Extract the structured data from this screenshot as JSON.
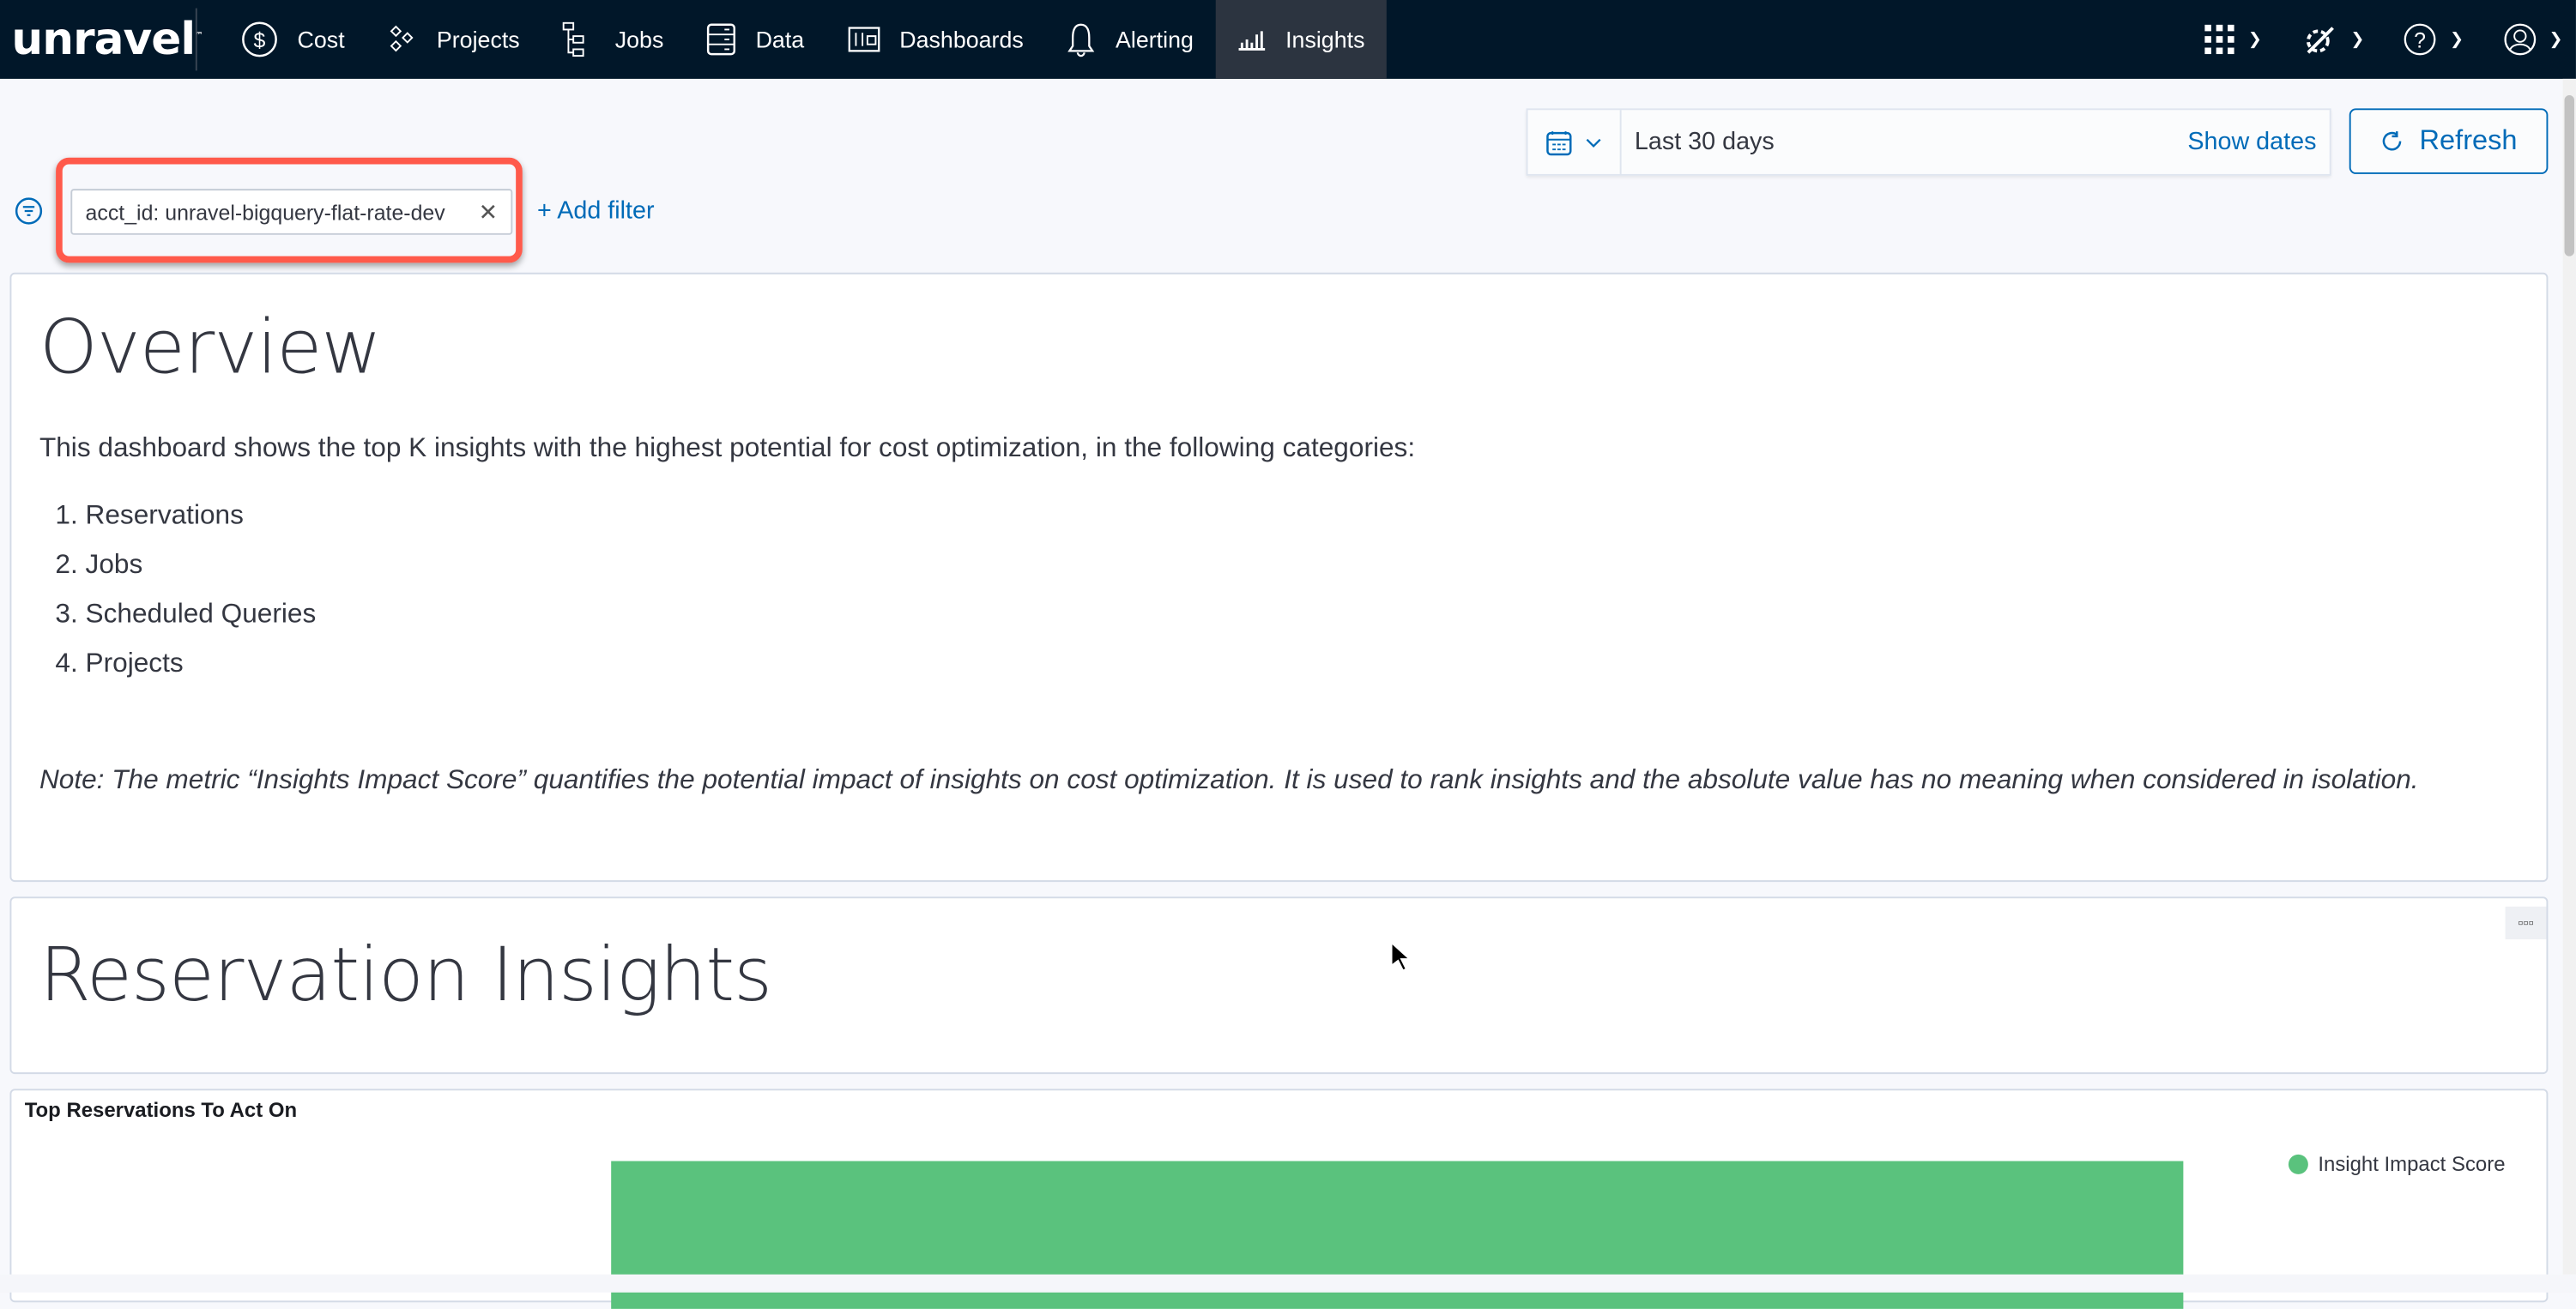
{
  "nav": {
    "logo": "unravel",
    "items": [
      {
        "label": "Cost",
        "icon": "dollar-circle-icon"
      },
      {
        "label": "Projects",
        "icon": "projects-icon"
      },
      {
        "label": "Jobs",
        "icon": "jobs-icon"
      },
      {
        "label": "Data",
        "icon": "database-icon"
      },
      {
        "label": "Dashboards",
        "icon": "dashboard-icon"
      },
      {
        "label": "Alerting",
        "icon": "bell-icon"
      },
      {
        "label": "Insights",
        "icon": "bar-chart-icon",
        "active": true
      }
    ],
    "right_icons": [
      "apps-grid-icon",
      "settings-wrench-icon",
      "help-icon",
      "user-icon"
    ]
  },
  "toolbar": {
    "date_range": "Last 30 days",
    "show_dates": "Show dates",
    "refresh": "Refresh"
  },
  "filters": {
    "active": [
      {
        "label": "acct_id: unravel-bigquery-flat-rate-dev"
      }
    ],
    "add_filter": "+ Add filter",
    "highlight_color": "#ff5a4b"
  },
  "overview": {
    "title": "Overview",
    "intro": "This dashboard shows the top K insights with the highest potential for cost optimization, in the following categories:",
    "categories": [
      "Reservations",
      "Jobs",
      "Scheduled Queries",
      "Projects"
    ],
    "note": "Note: The metric “Insights Impact Score” quantifies the potential impact of insights on cost optimization. It is used to rank insights and the absolute value has no meaning when considered in isolation."
  },
  "reservation": {
    "title": "Reservation Insights"
  },
  "chart_data": {
    "type": "bar",
    "title": "Top Reservations To Act On",
    "legend": "top-right",
    "series": [
      {
        "name": "Insight Impact Score",
        "color": "#5ac27d"
      }
    ]
  },
  "colors": {
    "accent": "#006bb8",
    "nav_bg": "#011729",
    "bar": "#5ac27d"
  }
}
